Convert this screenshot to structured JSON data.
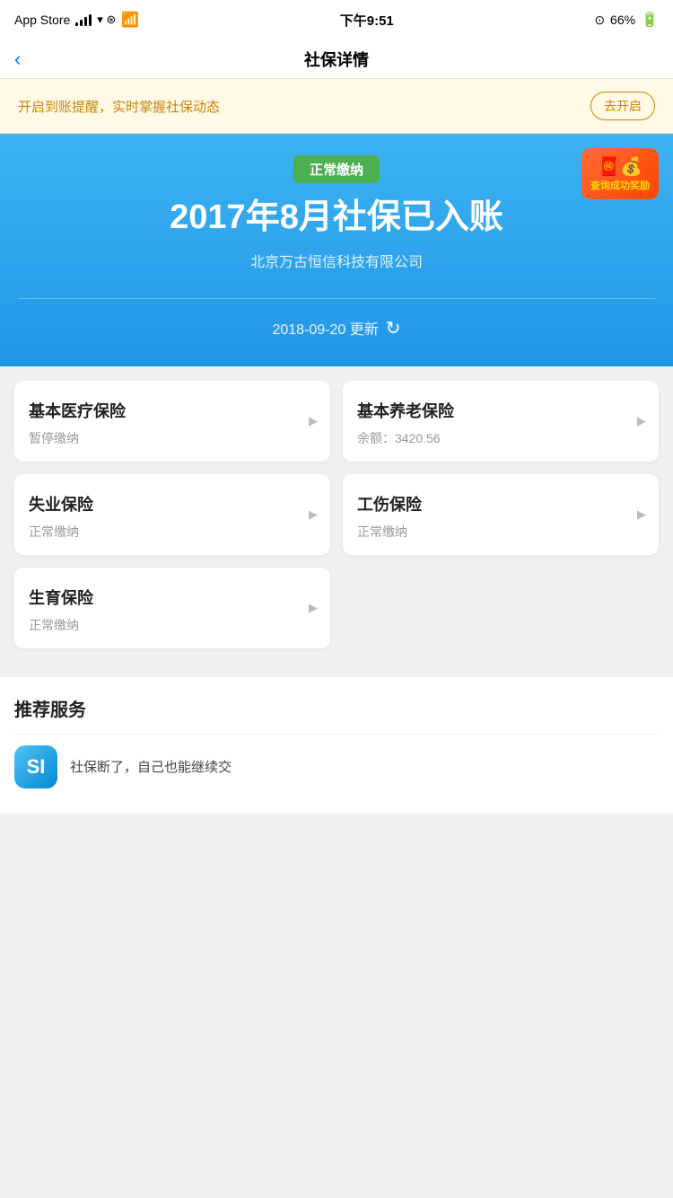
{
  "statusBar": {
    "carrier": "App Store",
    "time": "下午9:51",
    "battery": "66%"
  },
  "navBar": {
    "title": "社保详情",
    "backLabel": "‹"
  },
  "notificationBanner": {
    "text": "开启到账提醒，实时掌握社保动态",
    "buttonLabel": "去开启"
  },
  "hero": {
    "statusBadge": "正常缴纳",
    "title": "2017年8月社保已入账",
    "subtitle": "北京万古恒信科技有限公司",
    "updateDate": "2018-09-20 更新",
    "rewardText": "查询成功奖励"
  },
  "insuranceCards": [
    {
      "title": "基本医疗保险",
      "status": "暂停缴纳",
      "balance": null
    },
    {
      "title": "基本养老保险",
      "status": null,
      "balance": "余额：3420.56"
    },
    {
      "title": "失业保险",
      "status": "正常缴纳",
      "balance": null
    },
    {
      "title": "工伤保险",
      "status": "正常缴纳",
      "balance": null
    },
    {
      "title": "生育保险",
      "status": "正常缴纳",
      "balance": null
    }
  ],
  "recommendedSection": {
    "title": "推荐服务",
    "items": [
      {
        "icon": "SI",
        "text": "社保断了，自己也能继续交"
      }
    ]
  }
}
